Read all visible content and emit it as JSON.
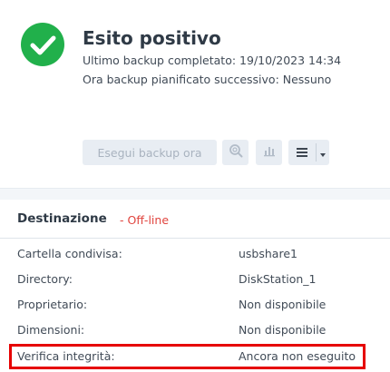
{
  "status": {
    "title": "Esito positivo",
    "last_backup": "Ultimo backup completato: 19/10/2023 14:34",
    "next_backup": "Ora backup pianificato successivo: Nessuno",
    "icon": "check-circle-icon",
    "color": "#21b04b"
  },
  "toolbar": {
    "backup_now_label": "Esegui backup ora",
    "search_icon": "search-icon",
    "chart_icon": "bar-chart-icon",
    "menu_icon": "hamburger-menu-icon",
    "dropdown_icon": "caret-down-icon"
  },
  "destination": {
    "title": "Destinazione",
    "status": "- Off-line",
    "status_color": "#e0443e",
    "rows": [
      {
        "label": "Cartella condivisa:",
        "value": "usbshare1"
      },
      {
        "label": "Directory:",
        "value": "DiskStation_1"
      },
      {
        "label": "Proprietario:",
        "value": "Non disponibile"
      },
      {
        "label": "Dimensioni:",
        "value": "Non disponibile"
      },
      {
        "label": "Verifica integrità:",
        "value": "Ancora non eseguito"
      }
    ]
  },
  "highlight_color": "#e60000"
}
